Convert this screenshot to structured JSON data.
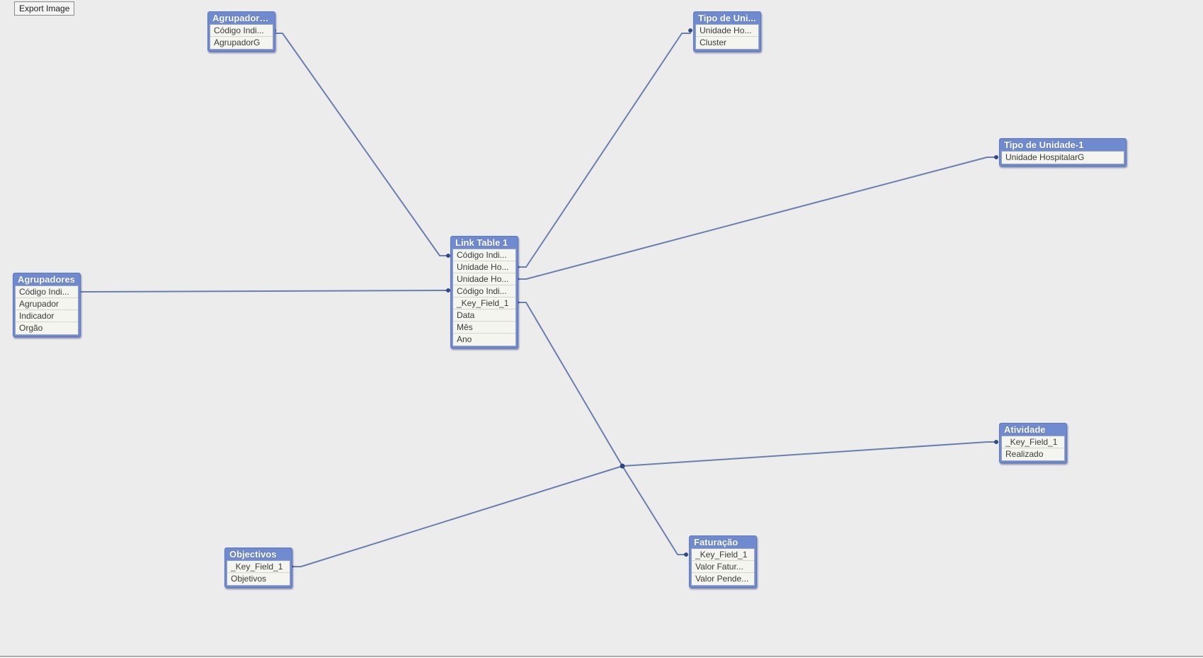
{
  "toolbar": {
    "export_label": "Export Image"
  },
  "colors": {
    "background": "#ececec",
    "table_header": "#6f8acf",
    "field_background": "#f5f5ef",
    "link_line": "#6b7fae"
  },
  "tables": [
    {
      "id": "agrupadoresg",
      "title": "AgrupadoresG",
      "fields": [
        "Código Indi...",
        "AgrupadorG"
      ]
    },
    {
      "id": "tipo-de-unidade",
      "title": "Tipo de Uni...",
      "fields": [
        "Unidade Ho...",
        "Cluster"
      ]
    },
    {
      "id": "tipo-de-unidade-1",
      "title": "Tipo de Unidade-1",
      "fields": [
        "Unidade HospitalarG"
      ]
    },
    {
      "id": "link-table-1",
      "title": "Link Table 1",
      "fields": [
        "Código Indi...",
        "Unidade Ho...",
        "Unidade Ho...",
        "Código Indi...",
        "_Key_Field_1",
        "Data",
        "Mês",
        "Ano"
      ]
    },
    {
      "id": "agrupadores",
      "title": "Agrupadores",
      "fields": [
        "Código Indi...",
        "Agrupador",
        "Indicador",
        "Orgão"
      ]
    },
    {
      "id": "atividade",
      "title": "Atividade",
      "fields": [
        "_Key_Field_1",
        "Realizado"
      ]
    },
    {
      "id": "objectivos",
      "title": "Objectivos",
      "fields": [
        "_Key_Field_1",
        "Objetivos"
      ]
    },
    {
      "id": "faturacao",
      "title": "Faturação",
      "fields": [
        "_Key_Field_1",
        "Valor Fatur...",
        "Valor Pende..."
      ]
    }
  ]
}
